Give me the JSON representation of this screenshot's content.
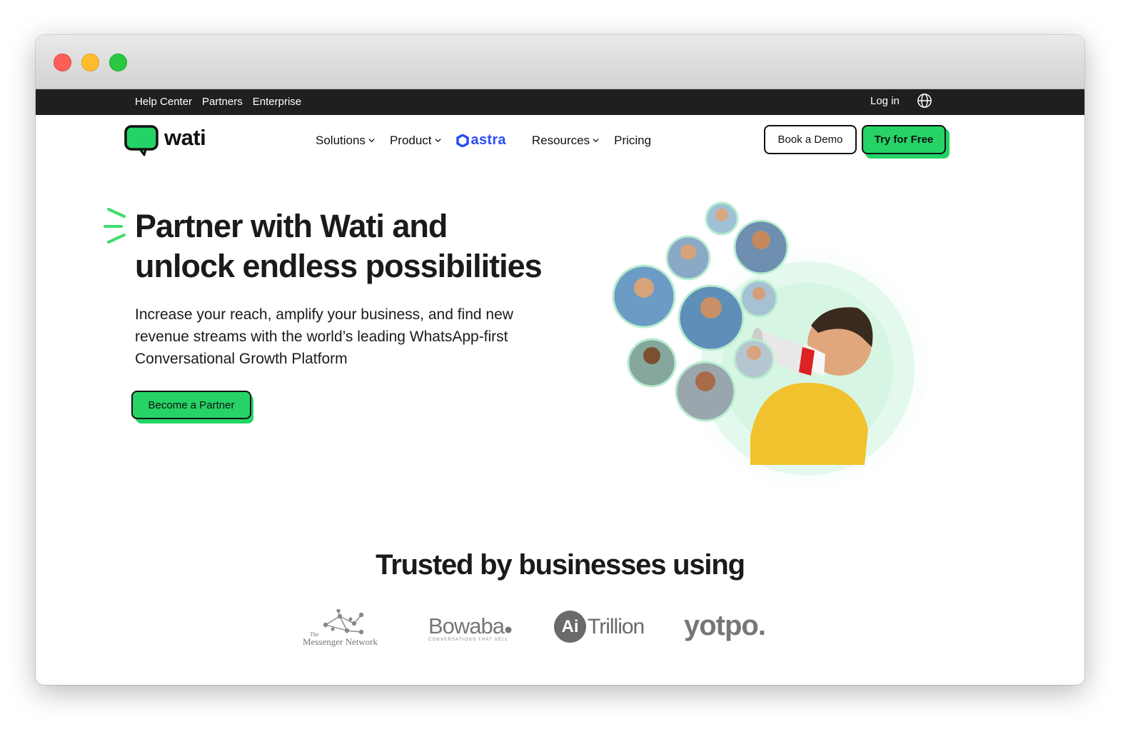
{
  "topbar": {
    "links": [
      "Help Center",
      "Partners",
      "Enterprise"
    ],
    "login": "Log in"
  },
  "nav": {
    "brand": "wati",
    "solutions": "Solutions",
    "product": "Product",
    "astra": "astra",
    "resources": "Resources",
    "pricing": "Pricing",
    "book_demo": "Book a Demo",
    "try_free": "Try for Free"
  },
  "hero": {
    "title_line1": "Partner with Wati and",
    "title_line2": "unlock endless possibilities",
    "subtitle": "Increase your reach, amplify your business, and find new revenue streams with the world’s leading WhatsApp-first Conversational Growth Platform",
    "cta": "Become a Partner"
  },
  "trusted": {
    "heading": "Trusted by businesses using",
    "logos": {
      "messenger_small": "The",
      "messenger": "Messenger Network",
      "bowaba": "Bowaba",
      "bowaba_tagline": "CONVERSATIONS THAT SELL",
      "ai": "Ai",
      "trillion": "Trillion",
      "yotpo": "yotpo."
    }
  },
  "colors": {
    "brand_green": "#25d366",
    "topbar_bg": "#1f1f1f",
    "astra_blue": "#2b4ef5",
    "text": "#1a1a1a"
  }
}
